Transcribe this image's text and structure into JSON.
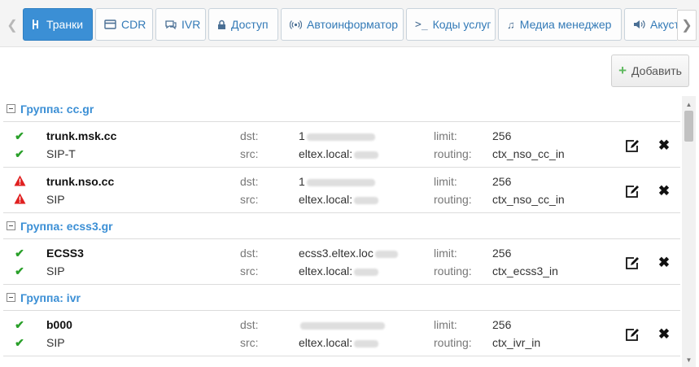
{
  "tabs": [
    {
      "label": "Транки",
      "icon": "trunk-icon",
      "active": true
    },
    {
      "label": "CDR",
      "icon": "card-icon",
      "active": false
    },
    {
      "label": "IVR",
      "icon": "chat-icon",
      "active": false
    },
    {
      "label": "Доступ",
      "icon": "lock-icon",
      "active": false
    },
    {
      "label": "Автоинформатор",
      "icon": "broadcast-icon",
      "active": false
    },
    {
      "label": "Коды услуг",
      "icon": "terminal-icon",
      "active": false
    },
    {
      "label": "Медиа менеджер",
      "icon": "music-icon",
      "active": false
    },
    {
      "label": "Акустика",
      "icon": "speaker-icon",
      "active": false
    }
  ],
  "toolbar": {
    "add_label": "Добавить"
  },
  "labels": {
    "dst": "dst:",
    "src": "src:",
    "limit": "limit:",
    "routing": "routing:"
  },
  "groups": [
    {
      "title": "Группа: cc.gr",
      "trunks": [
        {
          "name": "trunk.msk.cc",
          "protocol": "SIP-T",
          "status": "ok",
          "dst": "1",
          "src": "eltex.local:",
          "limit": "256",
          "routing": "ctx_nso_cc_in"
        },
        {
          "name": "trunk.nso.cc",
          "protocol": "SIP",
          "status": "warning",
          "dst": "1",
          "src": "eltex.local:",
          "limit": "256",
          "routing": "ctx_nso_cc_in"
        }
      ]
    },
    {
      "title": "Группа: ecss3.gr",
      "trunks": [
        {
          "name": "ECSS3",
          "protocol": "SIP",
          "status": "ok",
          "dst": "ecss3.eltex.loc",
          "src": "eltex.local:",
          "limit": "256",
          "routing": "ctx_ecss3_in"
        }
      ]
    },
    {
      "title": "Группа: ivr",
      "trunks": [
        {
          "name": "b000",
          "protocol": "SIP",
          "status": "ok",
          "dst": "",
          "src": "eltex.local:",
          "limit": "256",
          "routing": "ctx_ivr_in"
        }
      ]
    }
  ],
  "colors": {
    "accent": "#3b8fd5",
    "ok": "#2aa02a",
    "warning": "#e02020"
  }
}
